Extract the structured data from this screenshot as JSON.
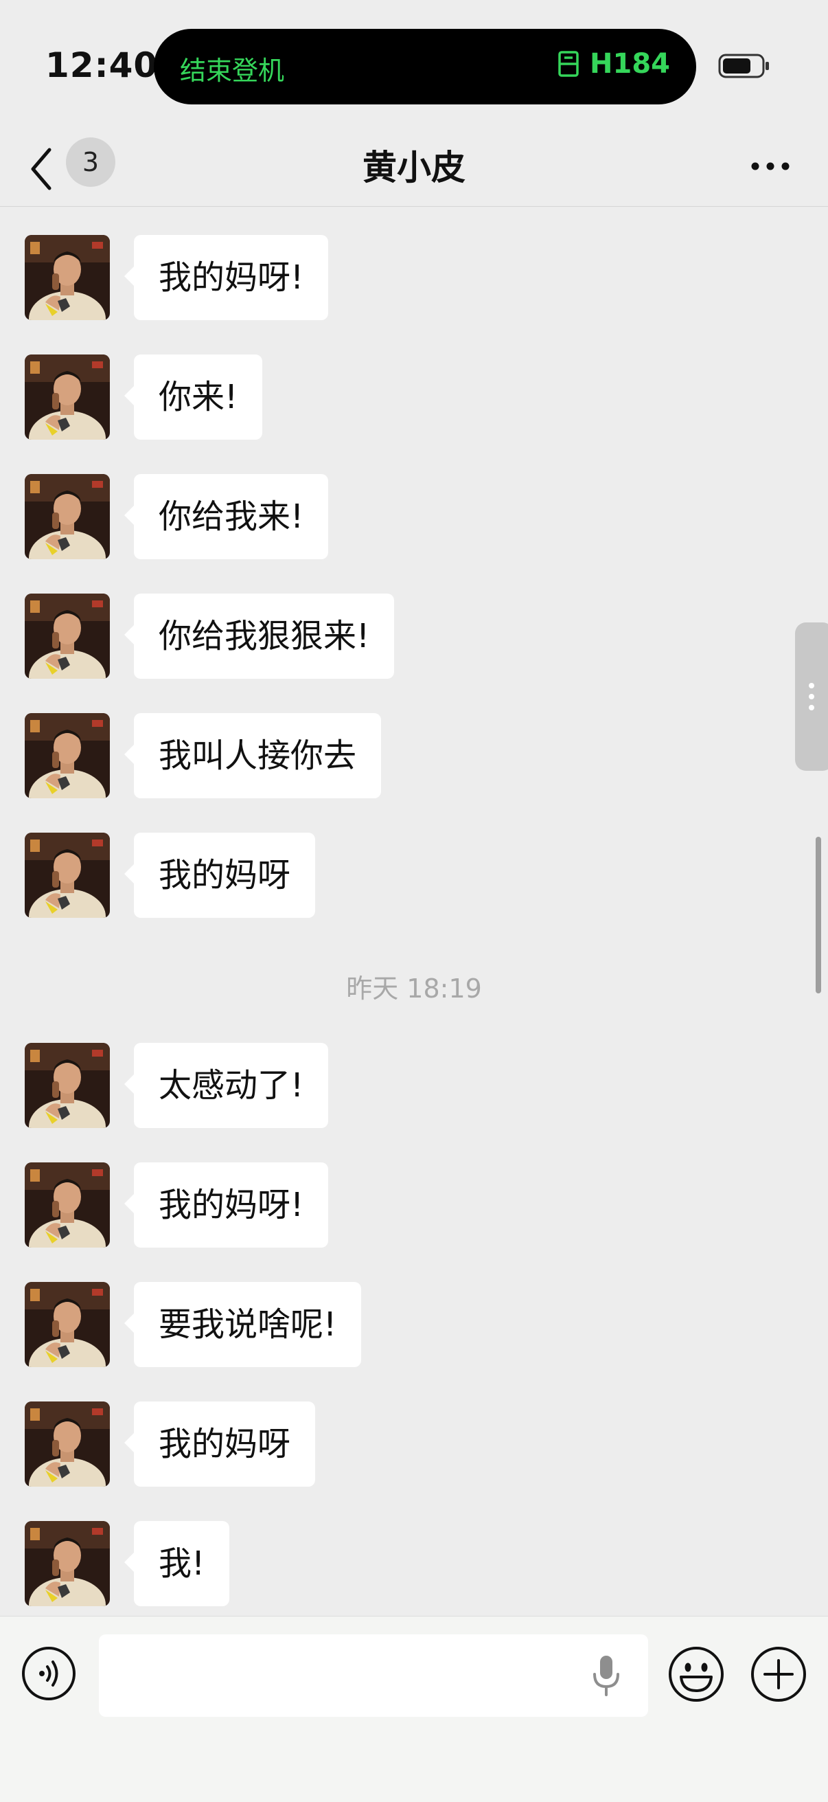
{
  "status_bar": {
    "time": "12:40",
    "island_left": "结束登机",
    "island_right": "H184"
  },
  "nav": {
    "unread_count": "3",
    "title": "黄小皮"
  },
  "messages": [
    {
      "text": "我的妈呀!"
    },
    {
      "text": "你来!"
    },
    {
      "text": "你给我来!"
    },
    {
      "text": "你给我狠狠来!"
    },
    {
      "text": "我叫人接你去"
    },
    {
      "text": "我的妈呀"
    },
    {
      "text": " 太感动了!"
    },
    {
      "text": "我的妈呀!"
    },
    {
      "text": "要我说啥呢!"
    },
    {
      "text": "我的妈呀"
    },
    {
      "text": "我!"
    }
  ],
  "timestamp": "昨天 18:19",
  "input": {
    "placeholder": ""
  },
  "colors": {
    "island_accent": "#35D65A",
    "background": "#EDEDED",
    "bubble": "#FFFFFF"
  }
}
